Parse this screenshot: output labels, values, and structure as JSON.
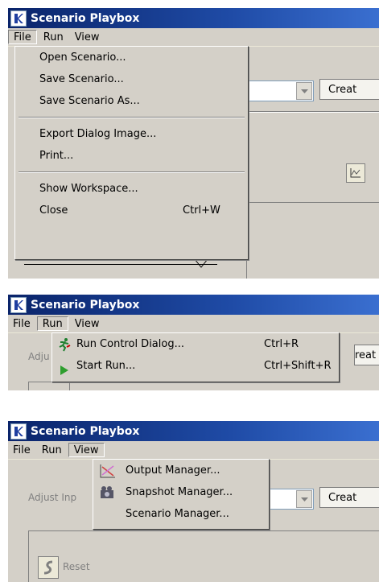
{
  "panel1": {
    "title": "Scenario Playbox",
    "menus": [
      "File",
      "Run",
      "View"
    ],
    "open_menu": "File",
    "dropdown": [
      {
        "label": "Open Scenario...",
        "shortcut": ""
      },
      {
        "label": "Save Scenario...",
        "shortcut": ""
      },
      {
        "label": "Save Scenario As...",
        "shortcut": ""
      },
      {
        "label": "Export Dialog Image...",
        "shortcut": ""
      },
      {
        "label": "Print...",
        "shortcut": ""
      },
      {
        "label": "Show Workspace...",
        "shortcut": ""
      },
      {
        "label": "Close",
        "shortcut": "Ctrl+W"
      }
    ],
    "create_button": "Creat"
  },
  "panel2": {
    "title": "Scenario Playbox",
    "menus": [
      "File",
      "Run",
      "View"
    ],
    "open_menu": "Run",
    "background_label": "Adju",
    "dropdown": [
      {
        "label": "Run Control Dialog...",
        "shortcut": "Ctrl+R",
        "icon": "runner-icon"
      },
      {
        "label": "Start Run...",
        "shortcut": "Ctrl+Shift+R",
        "icon": "play-icon"
      }
    ],
    "create_button": "reat"
  },
  "panel3": {
    "title": "Scenario Playbox",
    "menus": [
      "File",
      "Run",
      "View"
    ],
    "open_menu": "View",
    "background_label": "Adjust Inp",
    "reset_label": "Reset",
    "dropdown": [
      {
        "label": "Output Manager...",
        "icon": "chart-icon"
      },
      {
        "label": "Snapshot Manager...",
        "icon": "camera-icon"
      },
      {
        "label": "Scenario Manager...",
        "icon": ""
      }
    ],
    "create_button": "Creat"
  },
  "colors": {
    "titlebar": "#0a246a",
    "menu_bg": "#d4d0c8",
    "play_green": "#2e9e2e"
  }
}
